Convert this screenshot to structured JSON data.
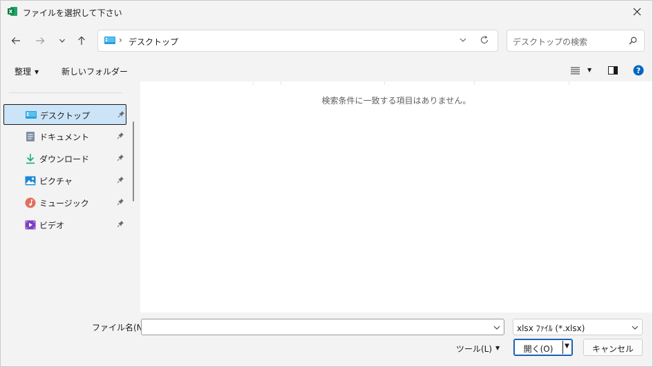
{
  "window": {
    "title": "ファイルを選択して下さい"
  },
  "address": {
    "separator": "›",
    "location": "デスクトップ"
  },
  "search": {
    "placeholder": "デスクトップの検索"
  },
  "toolbar": {
    "organize_label": "整理",
    "new_folder_label": "新しいフォルダー"
  },
  "sidebar": {
    "items": [
      {
        "label": "デスクトップ",
        "icon": "desktop-icon",
        "selected": true
      },
      {
        "label": "ドキュメント",
        "icon": "documents-icon"
      },
      {
        "label": "ダウンロード",
        "icon": "download-icon"
      },
      {
        "label": "ピクチャ",
        "icon": "pictures-icon"
      },
      {
        "label": "ミュージック",
        "icon": "music-icon"
      },
      {
        "label": "ビデオ",
        "icon": "video-icon"
      }
    ]
  },
  "content": {
    "empty_message": "検索条件に一致する項目はありません。"
  },
  "footer": {
    "filename_label": "ファイル名(N):",
    "filename_value": "",
    "filetype_value": "xlsx ﾌｧｲﾙ (*.xlsx)",
    "tools_label": "ツール(L)",
    "open_label": "開く(O)",
    "cancel_label": "キャンセル"
  },
  "colors": {
    "accent": "#1a5fb4",
    "selection": "#cce4f7",
    "help": "#0067c0"
  }
}
